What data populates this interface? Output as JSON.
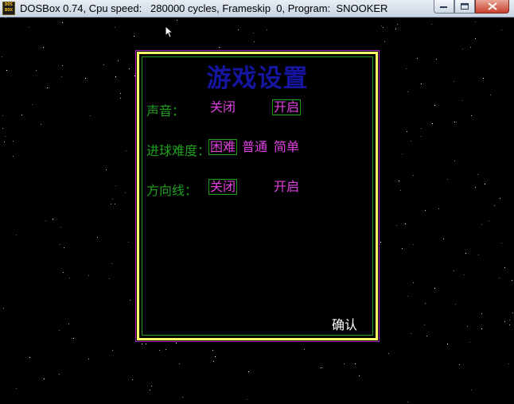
{
  "window": {
    "title": "DOSBox 0.74, Cpu speed:   280000 cycles, Frameskip  0, Program:  SNOOKER",
    "icon_name": "dosbox-icon",
    "icon_text_top": "DOS",
    "icon_text_bottom": "BOX",
    "minimize_icon": "minimize-icon",
    "maximize_icon": "maximize-icon",
    "close_icon": "close-icon"
  },
  "dialog": {
    "title": "游戏设置",
    "sound": {
      "label": "声音：",
      "options": [
        "关闭",
        "开启"
      ],
      "selected": "开启"
    },
    "difficulty": {
      "label": "进球难度：",
      "options": [
        "困难",
        "普通",
        "简单"
      ],
      "selected": "困难"
    },
    "direction_line": {
      "label": "方向线：",
      "options": [
        "关闭",
        "开启"
      ],
      "selected": "关闭"
    },
    "confirm_label": "确认"
  },
  "colors": {
    "background": "#000000",
    "title": "#1515a0",
    "label": "#1fa01f",
    "option": "#e040e0",
    "border_yellow": "#ffff66",
    "border_green": "#1fa01f",
    "confirm": "#ffffff"
  }
}
